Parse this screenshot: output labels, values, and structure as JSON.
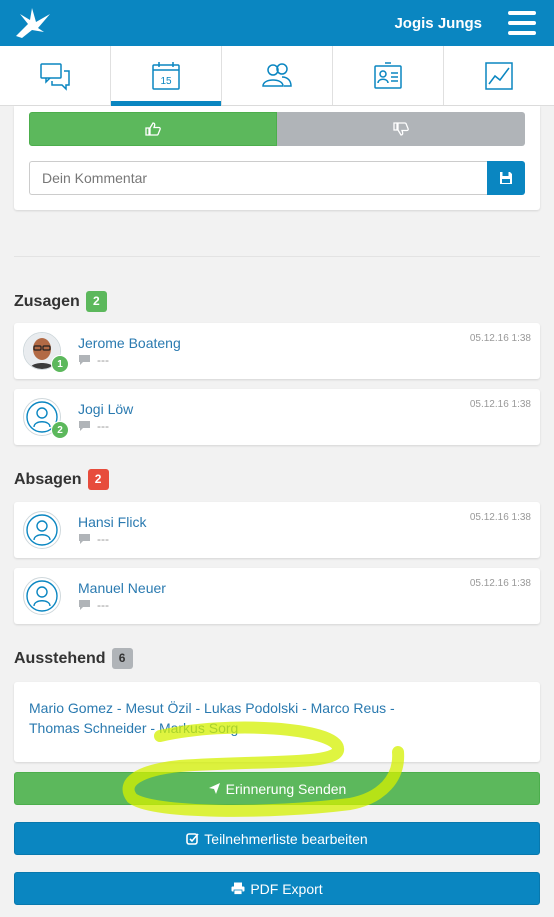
{
  "header": {
    "team_name": "Jogis Jungs"
  },
  "tabs": [
    {
      "name": "chat",
      "icon": "chat-icon",
      "active": false
    },
    {
      "name": "calendar",
      "icon": "calendar-icon",
      "label": "15",
      "active": true
    },
    {
      "name": "team",
      "icon": "users-icon",
      "active": false
    },
    {
      "name": "profile",
      "icon": "id-card-icon",
      "active": false
    },
    {
      "name": "stats",
      "icon": "chart-icon",
      "active": false
    }
  ],
  "vote": {
    "comment_placeholder": "Dein Kommentar"
  },
  "sections": {
    "zusagen": {
      "title": "Zusagen",
      "count": "2",
      "people": [
        {
          "name": "Jerome Boateng",
          "comment": "---",
          "time": "05.12.16 1:38",
          "guests": "1"
        },
        {
          "name": "Jogi Löw",
          "comment": "---",
          "time": "05.12.16 1:38",
          "guests": "2"
        }
      ]
    },
    "absagen": {
      "title": "Absagen",
      "count": "2",
      "people": [
        {
          "name": "Hansi Flick",
          "comment": "---",
          "time": "05.12.16 1:38"
        },
        {
          "name": "Manuel Neuer",
          "comment": "---",
          "time": "05.12.16 1:38"
        }
      ]
    },
    "ausstehend": {
      "title": "Ausstehend",
      "count": "6",
      "line1": "Mario Gomez - Mesut Özil - Lukas Podolski - Marco Reus -",
      "line2": "Thomas Schneider - Markus Sorg"
    }
  },
  "buttons": {
    "remind": "Erinnerung Senden",
    "edit_list": "Teilnehmerliste bearbeiten",
    "pdf": "PDF Export"
  },
  "colors": {
    "primary": "#0a86c1",
    "accept": "#5cb85c",
    "decline": "#e74c3c",
    "neutral": "#b0b4b8",
    "highlight": "#d4f000"
  }
}
